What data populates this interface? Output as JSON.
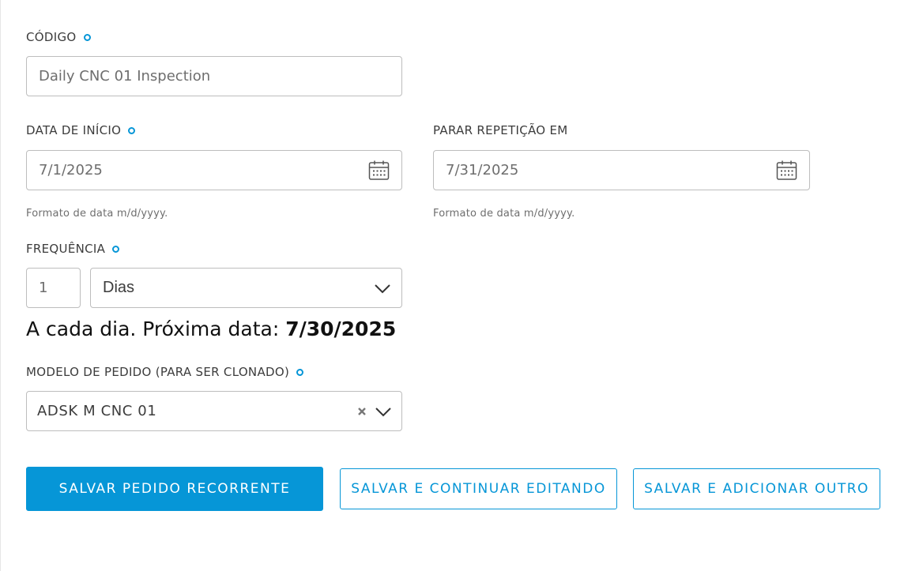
{
  "form": {
    "code": {
      "label": "CÓDIGO",
      "value": "Daily CNC 01 Inspection"
    },
    "start_date": {
      "label": "DATA DE INÍCIO",
      "value": "7/1/2025",
      "hint": "Formato de data m/d/yyyy."
    },
    "stop_repeat": {
      "label": "PARAR REPETIÇÃO EM",
      "value": "7/31/2025",
      "hint": "Formato de data m/d/yyyy."
    },
    "frequency": {
      "label": "FREQUÊNCIA",
      "count": "1",
      "unit": "Dias"
    },
    "summary": {
      "text": "A cada dia. Próxima data: ",
      "next_date": "7/30/2025"
    },
    "order_template": {
      "label": "MODELO DE PEDIDO (PARA SER CLONADO)",
      "value": "ADSK M CNC 01"
    }
  },
  "buttons": {
    "save_recurring": "SALVAR PEDIDO RECORRENTE",
    "save_continue": "SALVAR E CONTINUAR EDITANDO",
    "save_add_another": "SALVAR E ADICIONAR OUTRO"
  },
  "colors": {
    "accent": "#0696d7",
    "border": "#bdbdbd",
    "text": "#3c3c3c"
  },
  "icons": {
    "required": "required-indicator-icon",
    "calendar": "calendar-icon",
    "dropdown": "chevron-down-icon",
    "clear": "clear-icon"
  }
}
